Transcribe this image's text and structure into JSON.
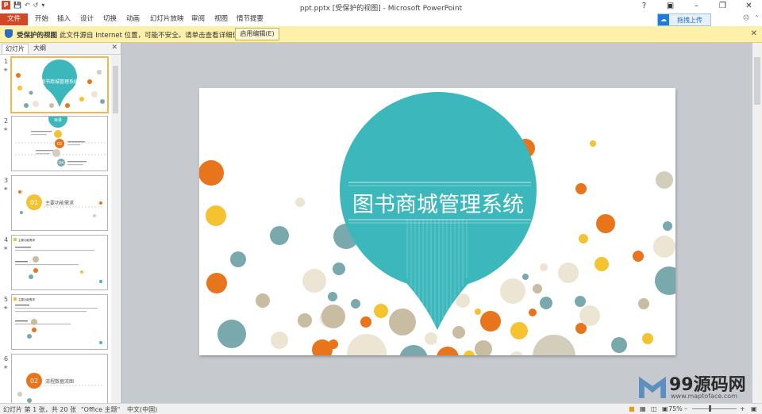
{
  "window": {
    "title": "ppt.pptx [受保护的视图] - Microsoft PowerPoint",
    "app_icon": "P",
    "controls": [
      "minimize-icon",
      "restore-icon",
      "close-icon"
    ]
  },
  "ribbon": {
    "file_label": "文件",
    "tabs": [
      "开始",
      "插入",
      "设计",
      "切换",
      "动画",
      "幻灯片放映",
      "审阅",
      "视图",
      "情节提要"
    ],
    "upload_label": "拖拽上传",
    "accent": "#d24726"
  },
  "protected_bar": {
    "title": "受保护的视图",
    "message": "此文件源自 Internet 位置，可能不安全。请单击查看详细信息。",
    "enable_button": "启用编辑(E)",
    "bg": "#fdf0a8"
  },
  "left_panel": {
    "tabs": [
      "幻灯片",
      "大纲"
    ],
    "slides": [
      {
        "num": "1",
        "title": "图书商城管理系统"
      },
      {
        "num": "2",
        "title": "目录",
        "items": [
          "01",
          "02",
          "03",
          "04"
        ]
      },
      {
        "num": "3",
        "title": "主要功能需求",
        "badge": "01"
      },
      {
        "num": "4",
        "title": "主要功能需求"
      },
      {
        "num": "5",
        "title": "主要功能需求"
      },
      {
        "num": "6",
        "title": "流程数据流图",
        "badge": "02"
      }
    ]
  },
  "slide": {
    "title": "图书商城管理系统",
    "teal": "#3cb8bd"
  },
  "status": {
    "slide_info": "幻灯片 第 1 张，共 20 张",
    "theme": "\"Office 主题\"",
    "language": "中文(中国)",
    "zoom": "75%"
  },
  "watermark": {
    "brand": "99源码网",
    "url": "www.maptoface.com"
  }
}
